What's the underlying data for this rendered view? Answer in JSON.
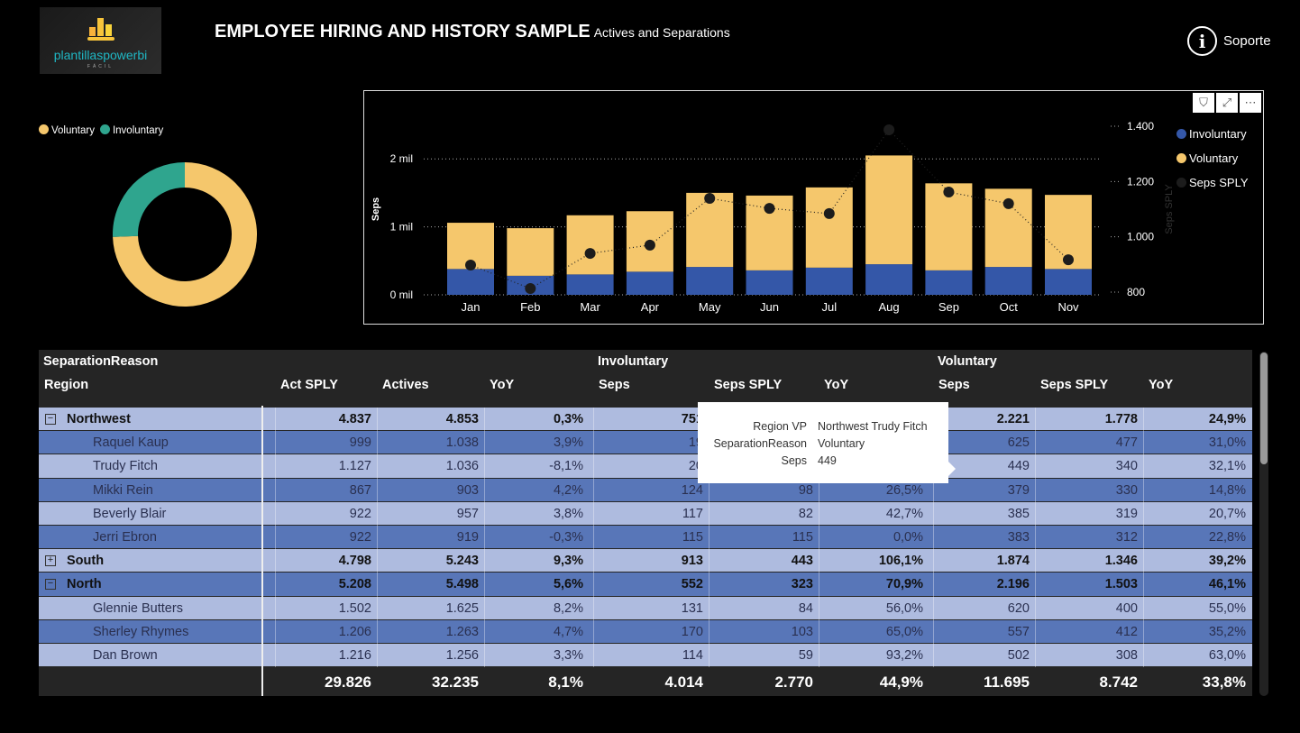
{
  "header": {
    "logo_text": "plantillaspowerbi",
    "logo_sub": "FÁCIL",
    "title": "EMPLOYEE HIRING AND HISTORY SAMPLE",
    "subtitle": "Actives and Separations",
    "support_label": "Soporte",
    "support_icon": "info-icon"
  },
  "colors": {
    "voluntary": "#f5c76c",
    "involuntary_donut": "#2fa58e",
    "involuntary_bar": "#3457a8",
    "sply": "#1c1c1c",
    "row_light": "#aebbdf",
    "row_dark": "#5876b8"
  },
  "donut": {
    "legend": [
      "Voluntary",
      "Involuntary"
    ],
    "values": [
      11695,
      4014
    ]
  },
  "chart_toolbar": {
    "filter_icon": "filter-icon",
    "focus_icon": "focus-mode-icon",
    "more_icon": "more-options-icon"
  },
  "chart_data": {
    "type": "bar+line",
    "categories": [
      "Jan",
      "Feb",
      "Mar",
      "Apr",
      "May",
      "Jun",
      "Jul",
      "Aug",
      "Sep",
      "Oct",
      "Nov"
    ],
    "series": [
      {
        "name": "Involuntary",
        "axis": "left",
        "values": [
          0.38,
          0.28,
          0.3,
          0.34,
          0.41,
          0.36,
          0.4,
          0.45,
          0.36,
          0.41,
          0.38
        ]
      },
      {
        "name": "Voluntary",
        "axis": "left",
        "values": [
          0.68,
          0.7,
          0.87,
          0.89,
          1.09,
          1.1,
          1.18,
          1.6,
          1.28,
          1.15,
          1.09
        ]
      },
      {
        "name": "Seps SPLY",
        "axis": "right",
        "values": [
          898,
          813,
          940,
          970,
          1139,
          1103,
          1084,
          1387,
          1162,
          1120,
          917
        ]
      }
    ],
    "ylabel": "Seps",
    "y2label": "Seps SPLY",
    "yticks": [
      "0 mil",
      "1 mil",
      "2 mil"
    ],
    "ytick_values": [
      0,
      1,
      2
    ],
    "y2ticks": [
      "800",
      "1.000",
      "1.200",
      "1.400"
    ],
    "y2tick_values": [
      800,
      1000,
      1200,
      1400
    ],
    "ylim": [
      0,
      2.48
    ],
    "y2lim": [
      790,
      1400
    ],
    "legend_position": "right",
    "grid": true
  },
  "table": {
    "group_headers": [
      "SeparationReason",
      "Involuntary",
      "Voluntary"
    ],
    "columns": [
      "Region",
      "Act SPLY",
      "Actives",
      "YoY",
      "Seps",
      "Seps SPLY",
      "YoY",
      "Seps",
      "Seps SPLY",
      "YoY"
    ],
    "rows": [
      {
        "level": 0,
        "expand": "minus",
        "cells": [
          "Northwest",
          "4.837",
          "4.853",
          "0,3%",
          "751",
          "",
          "",
          "2.221",
          "1.778",
          "24,9%"
        ]
      },
      {
        "level": 1,
        "cells": [
          "Raquel Kaup",
          "999",
          "1.038",
          "3,9%",
          "19",
          "",
          "",
          "625",
          "477",
          "31,0%"
        ]
      },
      {
        "level": 1,
        "cells": [
          "Trudy Fitch",
          "1.127",
          "1.036",
          "-8,1%",
          "20",
          "",
          "",
          "449",
          "340",
          "32,1%"
        ]
      },
      {
        "level": 1,
        "cells": [
          "Mikki Rein",
          "867",
          "903",
          "4,2%",
          "124",
          "98",
          "26,5%",
          "379",
          "330",
          "14,8%"
        ]
      },
      {
        "level": 1,
        "cells": [
          "Beverly Blair",
          "922",
          "957",
          "3,8%",
          "117",
          "82",
          "42,7%",
          "385",
          "319",
          "20,7%"
        ]
      },
      {
        "level": 1,
        "cells": [
          "Jerri Ebron",
          "922",
          "919",
          "-0,3%",
          "115",
          "115",
          "0,0%",
          "383",
          "312",
          "22,8%"
        ]
      },
      {
        "level": 0,
        "expand": "plus",
        "cells": [
          "South",
          "4.798",
          "5.243",
          "9,3%",
          "913",
          "443",
          "106,1%",
          "1.874",
          "1.346",
          "39,2%"
        ]
      },
      {
        "level": 0,
        "expand": "minus",
        "cells": [
          "North",
          "5.208",
          "5.498",
          "5,6%",
          "552",
          "323",
          "70,9%",
          "2.196",
          "1.503",
          "46,1%"
        ]
      },
      {
        "level": 1,
        "cells": [
          "Glennie Butters",
          "1.502",
          "1.625",
          "8,2%",
          "131",
          "84",
          "56,0%",
          "620",
          "400",
          "55,0%"
        ]
      },
      {
        "level": 1,
        "cells": [
          "Sherley Rhymes",
          "1.206",
          "1.263",
          "4,7%",
          "170",
          "103",
          "65,0%",
          "557",
          "412",
          "35,2%"
        ]
      },
      {
        "level": 1,
        "cells": [
          "Dan Brown",
          "1.216",
          "1.256",
          "3,3%",
          "114",
          "59",
          "93,2%",
          "502",
          "308",
          "63,0%"
        ]
      }
    ],
    "totals": [
      "",
      "29.826",
      "32.235",
      "8,1%",
      "4.014",
      "2.770",
      "44,9%",
      "11.695",
      "8.742",
      "33,8%"
    ]
  },
  "tooltip": {
    "rows": [
      {
        "key": "Region VP",
        "value": "Northwest Trudy Fitch"
      },
      {
        "key": "SeparationReason",
        "value": "Voluntary"
      },
      {
        "key": "Seps",
        "value": "449"
      }
    ]
  }
}
